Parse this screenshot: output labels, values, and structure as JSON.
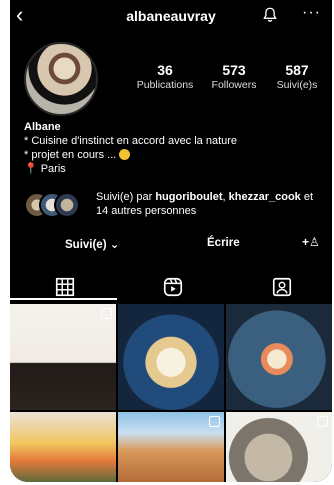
{
  "header": {
    "back_icon": "chevron-left-icon",
    "username": "albaneauvray",
    "bell_icon": "bell-icon",
    "more_icon": "more-icon",
    "more_glyph": "···"
  },
  "stats": {
    "posts": {
      "value": "36",
      "label": "Publications"
    },
    "followers": {
      "value": "573",
      "label": "Followers"
    },
    "following": {
      "value": "587",
      "label": "Suivi(e)s"
    }
  },
  "bio": {
    "name": "Albane",
    "line1": "* Cuisine d'instinct en accord avec la nature",
    "line2": "* projet en cours ...",
    "line3": "Paris",
    "pin_icon": "pin-icon",
    "smile_icon": "smile-emoji-icon"
  },
  "followed_by": {
    "prefix": "Suivi(e) par",
    "user1": "hugoriboulet",
    "separator": ",",
    "user2": "khezzar_cook",
    "suffix": "et 14 autres personnes"
  },
  "actions": {
    "follow_label": "Suivi(e) ⌄",
    "message_label": "Écrire",
    "add_icon": "add-person-icon",
    "add_glyph": "+♙"
  },
  "tabs": [
    {
      "icon": "grid-icon"
    },
    {
      "icon": "reels-icon"
    },
    {
      "icon": "tagged-icon"
    }
  ],
  "colors": {
    "background": "#000000",
    "text": "#ffffff",
    "pin": "#e8463a",
    "emoji": "#f1c232"
  }
}
